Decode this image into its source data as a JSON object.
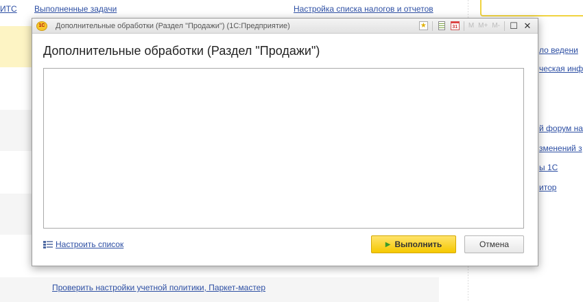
{
  "background": {
    "top_links": [
      "ИТС",
      "Выполненные задачи",
      "Настройка списка налогов и отчетов"
    ],
    "right_links": [
      "ло ведени",
      "ческая инф",
      "й форум на",
      "зменений з",
      "ы 1С",
      "итор"
    ],
    "bottom_link": "Проверить настройки учетной политики, Паркет-мастер"
  },
  "dialog": {
    "logo_text": "1С",
    "window_title": "Дополнительные обработки (Раздел \"Продажи\")  (1С:Предприятие)",
    "heading": "Дополнительные обработки (Раздел \"Продажи\")",
    "toolbar": {
      "calendar_number": "31",
      "m_label": "M",
      "m_plus_label": "M+",
      "m_minus_label": "M-"
    },
    "configure_list_label": "Настроить список",
    "run_button_label": "Выполнить",
    "cancel_button_label": "Отмена"
  },
  "colors": {
    "accent_yellow": "#f5c800",
    "link_blue": "#2c4ea3"
  }
}
